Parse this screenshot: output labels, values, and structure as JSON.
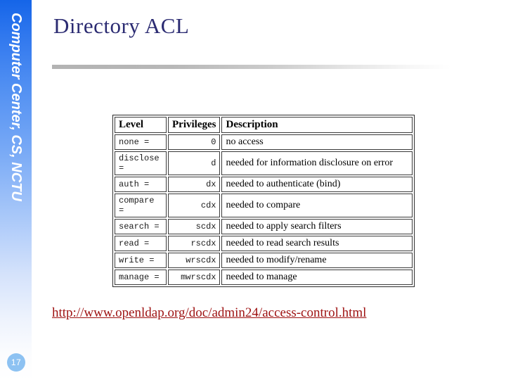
{
  "slide": {
    "number": "17",
    "banner_text": "Computer Center, CS, NCTU",
    "title": "Directory ACL"
  },
  "table": {
    "headers": [
      "Level",
      "Privileges",
      "Description"
    ],
    "rows": [
      {
        "level": "none =",
        "privileges": "0",
        "description": "no access"
      },
      {
        "level": "disclose =",
        "privileges": "d",
        "description": "needed for information disclosure on error"
      },
      {
        "level": "auth =",
        "privileges": "dx",
        "description": "needed to authenticate (bind)"
      },
      {
        "level": "compare =",
        "privileges": "cdx",
        "description": "needed to compare"
      },
      {
        "level": "search =",
        "privileges": "scdx",
        "description": "needed to apply search filters"
      },
      {
        "level": "read =",
        "privileges": "rscdx",
        "description": "needed to read search results"
      },
      {
        "level": "write =",
        "privileges": "wrscdx",
        "description": "needed to modify/rename"
      },
      {
        "level": "manage =",
        "privileges": "mwrscdx",
        "description": "needed to manage"
      }
    ]
  },
  "source": {
    "url_text": "http://www.openldap.org/doc/admin24/access-control.html"
  },
  "colors": {
    "banner_top": "#1565e8",
    "banner_bottom": "#ffffff",
    "title": "#2b2b72",
    "url": "#9e1212",
    "page_bubble": "#8dc2f2",
    "rule": "#b3b3b3"
  }
}
